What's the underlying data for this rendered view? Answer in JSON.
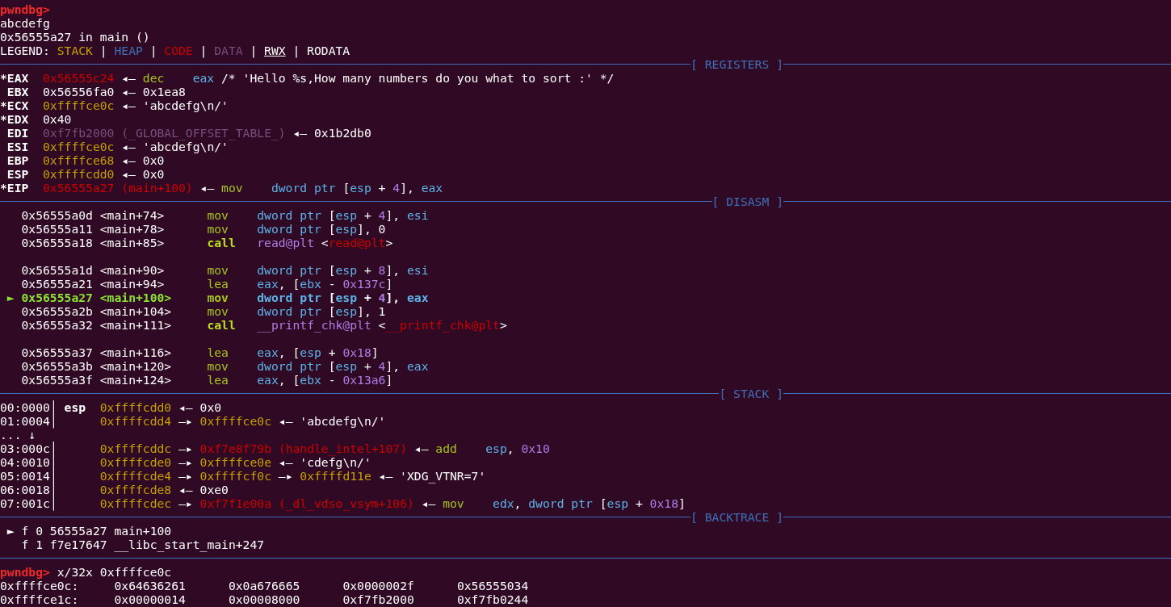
{
  "lines": [
    {
      "kind": "plain",
      "cells": [
        {
          "kind": "prompt",
          "text": "pwndbg>",
          "color": "#ef2929"
        }
      ]
    },
    {
      "kind": "plain",
      "cells": [
        {
          "kind": "text",
          "text": "abcdefg"
        }
      ]
    },
    {
      "kind": "plain",
      "cells": [
        {
          "kind": "text",
          "text": "0x56555a27 in main ()"
        }
      ]
    },
    {
      "kind": "plain",
      "cells": [
        {
          "kind": "legend",
          "text": "LEGEND:"
        },
        {
          "kind": "legend_item",
          "text": "STACK",
          "color": "#c4a000"
        },
        {
          "kind": "separator",
          "text": "|"
        },
        {
          "kind": "legend_item",
          "text": "HEAP",
          "color": "#3f6fb8"
        },
        {
          "kind": "separator",
          "text": "|"
        },
        {
          "kind": "legend_item",
          "text": "CODE",
          "color": "#cc0000"
        },
        {
          "kind": "separator",
          "text": "|"
        },
        {
          "kind": "legend_item",
          "text": "DATA",
          "color": "#75507b"
        },
        {
          "kind": "separator",
          "text": "|"
        },
        {
          "kind": "underlined",
          "text": "RWX"
        },
        {
          "kind": "separator",
          "text": "|"
        },
        {
          "kind": "legend_item",
          "text": "RODATA"
        }
      ]
    },
    {
      "kind": "header",
      "title": "[ REGISTERS ]"
    },
    {
      "kind": "register",
      "cells": [
        {
          "kind": "register",
          "text": "*EAX"
        },
        {
          "kind": "address",
          "text": "0x56555c24",
          "color": "#cc0000"
        },
        {
          "kind": "arrow",
          "text": "◂—"
        },
        {
          "kind": "mnemonic",
          "text": "dec",
          "color": "#a6c41c"
        },
        {
          "kind": "operand",
          "text": "eax",
          "color": "#5cb3e8"
        },
        {
          "kind": "comment",
          "text": "/* 'Hello %s,How many numbers do you what to sort :' */"
        }
      ]
    },
    {
      "kind": "register",
      "cells": [
        {
          "kind": "register",
          "text": "EBX"
        },
        {
          "kind": "address",
          "text": "0x56556fa0"
        },
        {
          "kind": "arrow",
          "text": "◂—"
        },
        {
          "kind": "value",
          "text": "0x1ea8"
        }
      ]
    },
    {
      "kind": "register",
      "cells": [
        {
          "kind": "register",
          "text": "*ECX"
        },
        {
          "kind": "address",
          "text": "0xffffce0c",
          "color": "#c4a000"
        },
        {
          "kind": "arrow",
          "text": "◂—"
        },
        {
          "kind": "string",
          "text": "'abcdefg\\n/'"
        }
      ]
    },
    {
      "kind": "register",
      "cells": [
        {
          "kind": "register",
          "text": "*EDX"
        },
        {
          "kind": "value",
          "text": "0x40"
        }
      ]
    },
    {
      "kind": "register",
      "cells": [
        {
          "kind": "register",
          "text": "EDI"
        },
        {
          "kind": "address",
          "text": "0xf7fb2000",
          "color": "#75507b"
        },
        {
          "kind": "symbol",
          "text": "(_GLOBAL_OFFSET_TABLE_)",
          "color": "#75507b"
        },
        {
          "kind": "arrow",
          "text": "◂—"
        },
        {
          "kind": "value",
          "text": "0x1b2db0"
        }
      ]
    },
    {
      "kind": "register",
      "cells": [
        {
          "kind": "register",
          "text": "ESI"
        },
        {
          "kind": "address",
          "text": "0xffffce0c",
          "color": "#c4a000"
        },
        {
          "kind": "arrow",
          "text": "◂—"
        },
        {
          "kind": "string",
          "text": "'abcdefg\\n/'"
        }
      ]
    },
    {
      "kind": "register",
      "cells": [
        {
          "kind": "register",
          "text": "EBP"
        },
        {
          "kind": "address",
          "text": "0xffffce68",
          "color": "#c4a000"
        },
        {
          "kind": "arrow",
          "text": "◂—"
        },
        {
          "kind": "value",
          "text": "0x0"
        }
      ]
    },
    {
      "kind": "register",
      "cells": [
        {
          "kind": "register",
          "text": "ESP"
        },
        {
          "kind": "address",
          "text": "0xffffcdd0",
          "color": "#c4a000"
        },
        {
          "kind": "arrow",
          "text": "◂—"
        },
        {
          "kind": "value",
          "text": "0x0"
        }
      ]
    },
    {
      "kind": "register",
      "cells": [
        {
          "kind": "register",
          "text": "*EIP"
        },
        {
          "kind": "address",
          "text": "0x56555a27",
          "color": "#cc0000"
        },
        {
          "kind": "symbol",
          "text": "(main+100)",
          "color": "#cc0000"
        },
        {
          "kind": "arrow",
          "text": "◂—"
        },
        {
          "kind": "mnemonic",
          "text": "mov",
          "color": "#a6c41c"
        },
        {
          "kind": "operand",
          "parts": [
            {
              "text": "dword ptr ",
              "color": "#5cb3e8"
            },
            {
              "text": "["
            },
            {
              "text": "esp",
              "color": "#5cb3e8"
            },
            {
              "text": " + "
            },
            {
              "text": "4",
              "color": "#ad7fe6"
            },
            {
              "text": "], "
            },
            {
              "text": "eax",
              "color": "#5cb3e8"
            }
          ]
        }
      ]
    },
    {
      "kind": "header",
      "title": "[ DISASM ]"
    },
    {
      "kind": "disasm",
      "current": false,
      "cells": [
        {
          "kind": "address",
          "text": "0x56555a0d"
        },
        {
          "kind": "symbol",
          "text": "<main+74>"
        },
        {
          "kind": "mnemonic",
          "text": "mov",
          "color": "#a6c41c"
        },
        {
          "kind": "operand",
          "parts": [
            {
              "text": "dword ptr ",
              "color": "#5cb3e8"
            },
            {
              "text": "["
            },
            {
              "text": "esp",
              "color": "#5cb3e8"
            },
            {
              "text": " + "
            },
            {
              "text": "4",
              "color": "#ad7fe6"
            },
            {
              "text": "], "
            },
            {
              "text": "esi",
              "color": "#5cb3e8"
            }
          ]
        }
      ]
    },
    {
      "kind": "disasm",
      "current": false,
      "cells": [
        {
          "kind": "address",
          "text": "0x56555a11"
        },
        {
          "kind": "symbol",
          "text": "<main+78>"
        },
        {
          "kind": "mnemonic",
          "text": "mov",
          "color": "#a6c41c"
        },
        {
          "kind": "operand",
          "parts": [
            {
              "text": "dword ptr ",
              "color": "#5cb3e8"
            },
            {
              "text": "["
            },
            {
              "text": "esp",
              "color": "#5cb3e8"
            },
            {
              "text": "], 0"
            }
          ]
        }
      ]
    },
    {
      "kind": "disasm",
      "current": false,
      "cells": [
        {
          "kind": "address",
          "text": "0x56555a18"
        },
        {
          "kind": "symbol",
          "text": "<main+85>"
        },
        {
          "kind": "call",
          "text": "call",
          "color": "#b9e01e"
        },
        {
          "kind": "operand",
          "parts": [
            {
              "text": "read@plt",
              "color": "#ad7fe6"
            },
            {
              "text": " <"
            },
            {
              "text": "read@plt",
              "color": "#cc0000"
            },
            {
              "text": ">"
            }
          ]
        }
      ]
    },
    {
      "kind": "blank"
    },
    {
      "kind": "disasm",
      "current": false,
      "cells": [
        {
          "kind": "address",
          "text": "0x56555a1d"
        },
        {
          "kind": "symbol",
          "text": "<main+90>"
        },
        {
          "kind": "mnemonic",
          "text": "mov",
          "color": "#a6c41c"
        },
        {
          "kind": "operand",
          "parts": [
            {
              "text": "dword ptr ",
              "color": "#5cb3e8"
            },
            {
              "text": "["
            },
            {
              "text": "esp",
              "color": "#5cb3e8"
            },
            {
              "text": " + "
            },
            {
              "text": "8",
              "color": "#ad7fe6"
            },
            {
              "text": "], "
            },
            {
              "text": "esi",
              "color": "#5cb3e8"
            }
          ]
        }
      ]
    },
    {
      "kind": "disasm",
      "current": false,
      "cells": [
        {
          "kind": "address",
          "text": "0x56555a21"
        },
        {
          "kind": "symbol",
          "text": "<main+94>"
        },
        {
          "kind": "mnemonic",
          "text": "lea",
          "color": "#a6c41c"
        },
        {
          "kind": "operand",
          "parts": [
            {
              "text": "eax",
              "color": "#5cb3e8"
            },
            {
              "text": ", ["
            },
            {
              "text": "ebx",
              "color": "#5cb3e8"
            },
            {
              "text": " - "
            },
            {
              "text": "0x137c",
              "color": "#ad7fe6"
            },
            {
              "text": "]"
            }
          ]
        }
      ]
    },
    {
      "kind": "disasm",
      "current": true,
      "marker": "►",
      "cells": [
        {
          "kind": "address",
          "text": "0x56555a27"
        },
        {
          "kind": "symbol",
          "text": "<main+100>"
        },
        {
          "kind": "mnemonic",
          "text": "mov",
          "color": "#a6c41c"
        },
        {
          "kind": "operand",
          "parts": [
            {
              "text": "dword ptr ",
              "color": "#5cb3e8"
            },
            {
              "text": "["
            },
            {
              "text": "esp",
              "color": "#5cb3e8"
            },
            {
              "text": " + "
            },
            {
              "text": "4",
              "color": "#ad7fe6"
            },
            {
              "text": "], "
            },
            {
              "text": "eax",
              "color": "#5cb3e8"
            }
          ]
        }
      ]
    },
    {
      "kind": "disasm",
      "current": false,
      "cells": [
        {
          "kind": "address",
          "text": "0x56555a2b"
        },
        {
          "kind": "symbol",
          "text": "<main+104>"
        },
        {
          "kind": "mnemonic",
          "text": "mov",
          "color": "#a6c41c"
        },
        {
          "kind": "operand",
          "parts": [
            {
              "text": "dword ptr ",
              "color": "#5cb3e8"
            },
            {
              "text": "["
            },
            {
              "text": "esp",
              "color": "#5cb3e8"
            },
            {
              "text": "], 1"
            }
          ]
        }
      ]
    },
    {
      "kind": "disasm",
      "current": false,
      "cells": [
        {
          "kind": "address",
          "text": "0x56555a32"
        },
        {
          "kind": "symbol",
          "text": "<main+111>"
        },
        {
          "kind": "call",
          "text": "call",
          "color": "#b9e01e"
        },
        {
          "kind": "operand",
          "parts": [
            {
              "text": "__printf_chk@plt",
              "color": "#ad7fe6"
            },
            {
              "text": " <"
            },
            {
              "text": "__printf_chk@plt",
              "color": "#cc0000"
            },
            {
              "text": ">"
            }
          ]
        }
      ]
    },
    {
      "kind": "blank"
    },
    {
      "kind": "disasm",
      "current": false,
      "cells": [
        {
          "kind": "address",
          "text": "0x56555a37"
        },
        {
          "kind": "symbol",
          "text": "<main+116>"
        },
        {
          "kind": "mnemonic",
          "text": "lea",
          "color": "#a6c41c"
        },
        {
          "kind": "operand",
          "parts": [
            {
              "text": "eax",
              "color": "#5cb3e8"
            },
            {
              "text": ", ["
            },
            {
              "text": "esp",
              "color": "#5cb3e8"
            },
            {
              "text": " + "
            },
            {
              "text": "0x18",
              "color": "#ad7fe6"
            },
            {
              "text": "]"
            }
          ]
        }
      ]
    },
    {
      "kind": "disasm",
      "current": false,
      "cells": [
        {
          "kind": "address",
          "text": "0x56555a3b"
        },
        {
          "kind": "symbol",
          "text": "<main+120>"
        },
        {
          "kind": "mnemonic",
          "text": "mov",
          "color": "#a6c41c"
        },
        {
          "kind": "operand",
          "parts": [
            {
              "text": "dword ptr ",
              "color": "#5cb3e8"
            },
            {
              "text": "["
            },
            {
              "text": "esp",
              "color": "#5cb3e8"
            },
            {
              "text": " + "
            },
            {
              "text": "4",
              "color": "#ad7fe6"
            },
            {
              "text": "], "
            },
            {
              "text": "eax",
              "color": "#5cb3e8"
            }
          ]
        }
      ]
    },
    {
      "kind": "disasm",
      "current": false,
      "cells": [
        {
          "kind": "address",
          "text": "0x56555a3f"
        },
        {
          "kind": "symbol",
          "text": "<main+124>"
        },
        {
          "kind": "mnemonic",
          "text": "lea",
          "color": "#a6c41c"
        },
        {
          "kind": "operand",
          "parts": [
            {
              "text": "eax",
              "color": "#5cb3e8"
            },
            {
              "text": ", ["
            },
            {
              "text": "ebx",
              "color": "#5cb3e8"
            },
            {
              "text": " - "
            },
            {
              "text": "0x13a6",
              "color": "#ad7fe6"
            },
            {
              "text": "]"
            }
          ]
        }
      ]
    },
    {
      "kind": "header",
      "title": "[ STACK ]"
    },
    {
      "kind": "stack",
      "cells": [
        {
          "kind": "offset",
          "text": "00:0000│"
        },
        {
          "kind": "pointer",
          "text": "esp"
        },
        {
          "kind": "address",
          "text": "0xffffcdd0",
          "color": "#c4a000"
        },
        {
          "kind": "arrow",
          "text": "◂—"
        },
        {
          "kind": "value",
          "text": "0x0"
        }
      ]
    },
    {
      "kind": "stack",
      "cells": [
        {
          "kind": "offset",
          "text": "01:0004│"
        },
        {
          "kind": "address",
          "text": "0xffffcdd4",
          "color": "#c4a000"
        },
        {
          "kind": "arrow",
          "text": "—▸"
        },
        {
          "kind": "address",
          "text": "0xffffce0c",
          "color": "#c4a000"
        },
        {
          "kind": "arrow",
          "text": "◂—"
        },
        {
          "kind": "string",
          "text": "'abcdefg\\n/'"
        }
      ]
    },
    {
      "kind": "plain",
      "cells": [
        {
          "kind": "continuation",
          "text": "... ↓"
        }
      ]
    },
    {
      "kind": "stack",
      "cells": [
        {
          "kind": "offset",
          "text": "03:000c│"
        },
        {
          "kind": "address",
          "text": "0xffffcddc",
          "color": "#c4a000"
        },
        {
          "kind": "arrow",
          "text": "—▸"
        },
        {
          "kind": "address",
          "text": "0xf7e8f79b",
          "color": "#cc0000"
        },
        {
          "kind": "symbol",
          "text": "(handle_intel+107)",
          "color": "#cc0000"
        },
        {
          "kind": "arrow",
          "text": "◂—"
        },
        {
          "kind": "mnemonic",
          "text": "add",
          "color": "#a6c41c"
        },
        {
          "kind": "operand",
          "parts": [
            {
              "text": "esp",
              "color": "#5cb3e8"
            },
            {
              "text": ", "
            },
            {
              "text": "0x10",
              "color": "#ad7fe6"
            }
          ]
        }
      ]
    },
    {
      "kind": "stack",
      "cells": [
        {
          "kind": "offset",
          "text": "04:0010│"
        },
        {
          "kind": "address",
          "text": "0xffffcde0",
          "color": "#c4a000"
        },
        {
          "kind": "arrow",
          "text": "—▸"
        },
        {
          "kind": "address",
          "text": "0xffffce0e",
          "color": "#c4a000"
        },
        {
          "kind": "arrow",
          "text": "◂—"
        },
        {
          "kind": "string",
          "text": "'cdefg\\n/'"
        }
      ]
    },
    {
      "kind": "stack",
      "cells": [
        {
          "kind": "offset",
          "text": "05:0014│"
        },
        {
          "kind": "address",
          "text": "0xffffcde4",
          "color": "#c4a000"
        },
        {
          "kind": "arrow",
          "text": "—▸"
        },
        {
          "kind": "address",
          "text": "0xffffcf0c",
          "color": "#c4a000"
        },
        {
          "kind": "arrow",
          "text": "—▸"
        },
        {
          "kind": "address",
          "text": "0xffffd11e",
          "color": "#c4a000"
        },
        {
          "kind": "arrow",
          "text": "◂—"
        },
        {
          "kind": "string",
          "text": "'XDG_VTNR=7'"
        }
      ]
    },
    {
      "kind": "stack",
      "cells": [
        {
          "kind": "offset",
          "text": "06:0018│"
        },
        {
          "kind": "address",
          "text": "0xffffcde8",
          "color": "#c4a000"
        },
        {
          "kind": "arrow",
          "text": "◂—"
        },
        {
          "kind": "value",
          "text": "0xe0"
        }
      ]
    },
    {
      "kind": "stack",
      "cells": [
        {
          "kind": "offset",
          "text": "07:001c│"
        },
        {
          "kind": "address",
          "text": "0xffffcdec",
          "color": "#c4a000"
        },
        {
          "kind": "arrow",
          "text": "—▸"
        },
        {
          "kind": "address",
          "text": "0xf7f1e00a",
          "color": "#cc0000"
        },
        {
          "kind": "symbol",
          "text": "(_dl_vdso_vsym+106)",
          "color": "#cc0000"
        },
        {
          "kind": "arrow",
          "text": "◂—"
        },
        {
          "kind": "mnemonic",
          "text": "mov",
          "color": "#a6c41c"
        },
        {
          "kind": "operand",
          "parts": [
            {
              "text": "edx",
              "color": "#5cb3e8"
            },
            {
              "text": ", "
            },
            {
              "text": "dword ptr ",
              "color": "#5cb3e8"
            },
            {
              "text": "["
            },
            {
              "text": "esp",
              "color": "#5cb3e8"
            },
            {
              "text": " + "
            },
            {
              "text": "0x18",
              "color": "#ad7fe6"
            },
            {
              "text": "]"
            }
          ]
        }
      ]
    },
    {
      "kind": "header",
      "title": "[ BACKTRACE ]"
    },
    {
      "kind": "backtrace",
      "marker": "►",
      "cells": [
        {
          "kind": "frame",
          "text": "f 0"
        },
        {
          "kind": "address",
          "text": "56555a27"
        },
        {
          "kind": "symbol",
          "text": "main+100"
        }
      ]
    },
    {
      "kind": "backtrace",
      "cells": [
        {
          "kind": "frame",
          "text": "f 1"
        },
        {
          "kind": "address",
          "text": "f7e17647"
        },
        {
          "kind": "symbol",
          "text": "__libc_start_main+247"
        }
      ]
    },
    {
      "kind": "rule"
    },
    {
      "kind": "plain",
      "cells": [
        {
          "kind": "prompt",
          "text": "pwndbg>",
          "color": "#ef2929"
        },
        {
          "kind": "command",
          "text": "x/32x 0xffffce0c"
        }
      ]
    },
    {
      "kind": "memory",
      "cells": [
        {
          "kind": "address",
          "text": "0xffffce0c:"
        },
        {
          "kind": "value",
          "text": "0x64636261"
        },
        {
          "kind": "value",
          "text": "0x0a676665"
        },
        {
          "kind": "value",
          "text": "0x0000002f"
        },
        {
          "kind": "value",
          "text": "0x56555034"
        }
      ]
    },
    {
      "kind": "memory",
      "cells": [
        {
          "kind": "address",
          "text": "0xffffce1c:"
        },
        {
          "kind": "value",
          "text": "0x00000014"
        },
        {
          "kind": "value",
          "text": "0x00008000"
        },
        {
          "kind": "value",
          "text": "0xf7fb2000"
        },
        {
          "kind": "value",
          "text": "0xf7fb0244"
        }
      ]
    }
  ]
}
